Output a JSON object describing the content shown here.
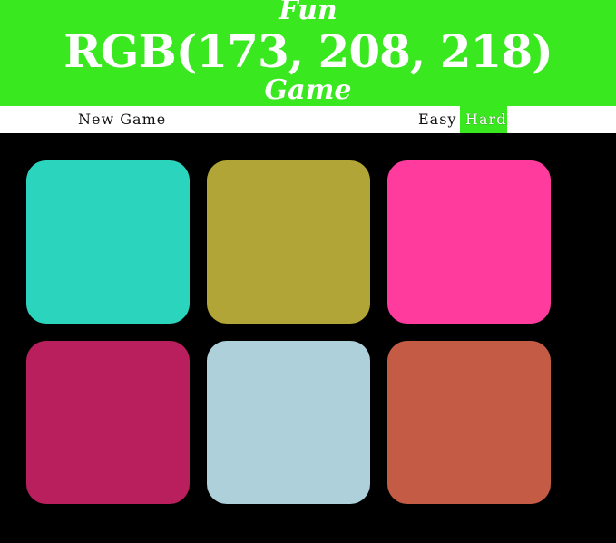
{
  "header": {
    "line1": "Fun",
    "rgb_target": "RGB(173, 208, 218)",
    "line3": "Game",
    "background_color": "#3ae81f"
  },
  "controls": {
    "new_game_label": "New Game",
    "easy_label": "Easy",
    "hard_label": "Hard",
    "selected_mode": "Hard"
  },
  "squares": [
    {
      "color": "#2bd4bd"
    },
    {
      "color": "#b1a537"
    },
    {
      "color": "#ff3c9e"
    },
    {
      "color": "#b91f5c"
    },
    {
      "color": "#add0da"
    },
    {
      "color": "#c45c45"
    }
  ]
}
